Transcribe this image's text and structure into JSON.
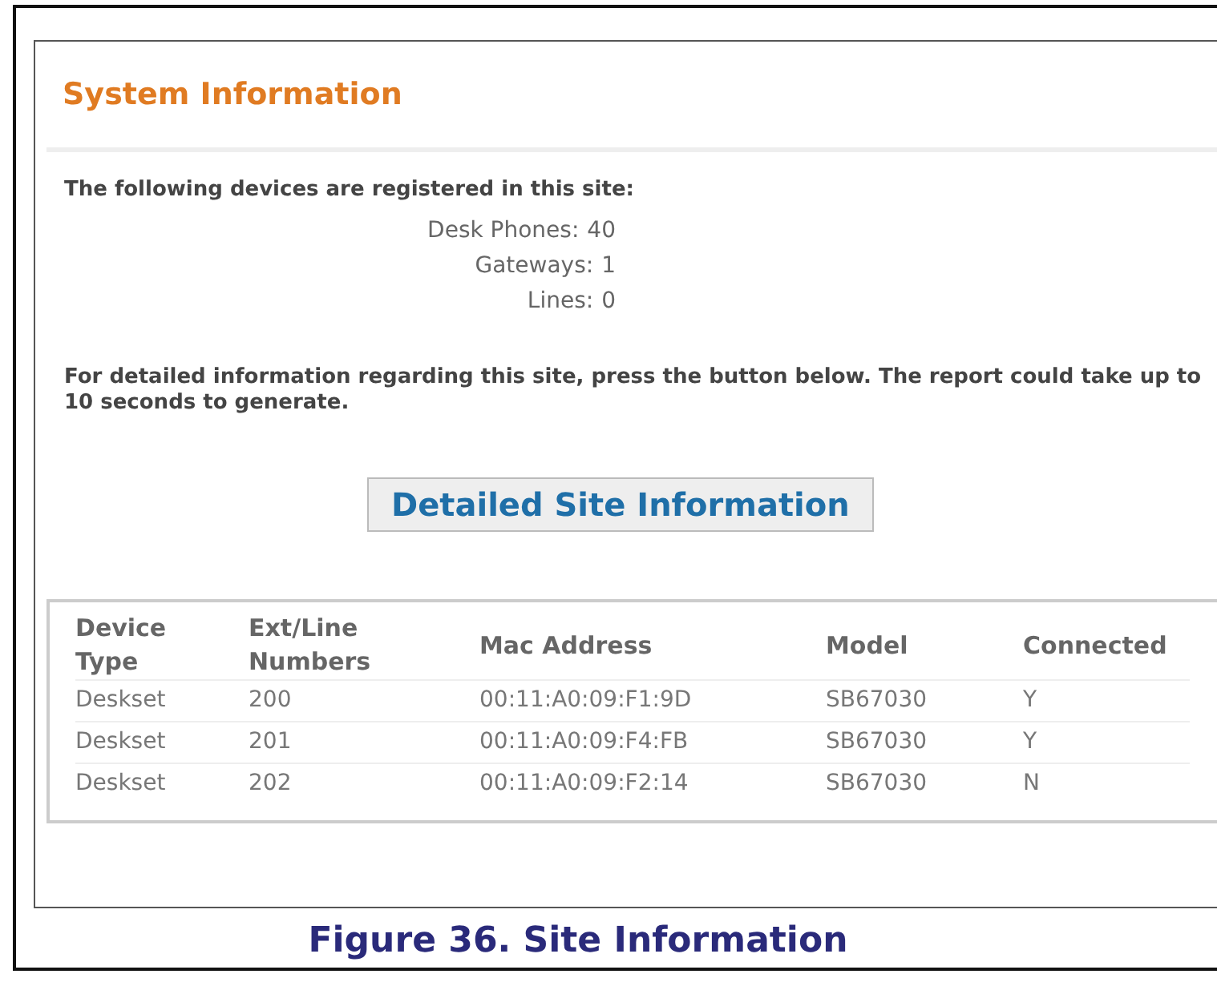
{
  "panel": {
    "title": "System Information",
    "intro": "The following devices are registered in this site:",
    "counts": [
      {
        "label": "Desk Phones:",
        "value": "40"
      },
      {
        "label": "Gateways:",
        "value": "1"
      },
      {
        "label": "Lines:",
        "value": "0"
      }
    ],
    "note": "For detailed information regarding this site, press the button below. The report could take up to 10 seconds to generate.",
    "button": "Detailed Site Information",
    "table": {
      "columns": [
        "Device Type",
        "Ext/Line Numbers",
        "Mac Address",
        "Model",
        "Connected"
      ],
      "rows": [
        [
          "Deskset",
          "200",
          "00:11:A0:09:F1:9D",
          "SB67030",
          "Y"
        ],
        [
          "Deskset",
          "201",
          "00:11:A0:09:F4:FB",
          "SB67030",
          "Y"
        ],
        [
          "Deskset",
          "202",
          "00:11:A0:09:F2:14",
          "SB67030",
          "N"
        ]
      ]
    }
  },
  "caption": "Figure 36.  Site Information"
}
